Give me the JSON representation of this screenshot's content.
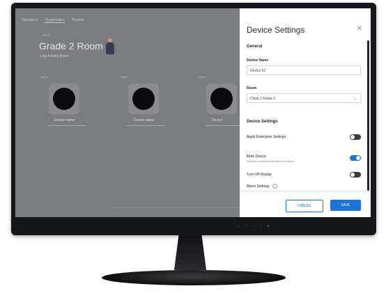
{
  "app": {
    "tabs": [
      "Operations",
      "Organization",
      "Devices"
    ],
    "back": "< BACK",
    "title": "Grade 2 Room C",
    "subtitle": "Low Activity Room",
    "devices": [
      {
        "label": "Tablet",
        "name": "Device name"
      },
      {
        "label": "Tablet",
        "name": "Device name"
      },
      {
        "label": "Tablet",
        "name": "Device"
      }
    ]
  },
  "panel": {
    "title": "Device Settings",
    "close_icon": "close-icon",
    "general_heading": "General",
    "device_name_label": "Device Name",
    "device_name_value": "Device 01",
    "room_label": "Room",
    "room_value": "Class 1 Grade 2",
    "device_settings_heading": "Device Settings",
    "apply_enterprise": {
      "label": "Apply Enterprise Settings",
      "on": false
    },
    "mute_device": {
      "label": "Mute Device",
      "help": "No alarm sound when the device is in alarm",
      "on": true
    },
    "turn_off_display": {
      "label": "Turn Off Display",
      "on": false
    },
    "alarm_settings": {
      "label": "Alarm Settings"
    },
    "cancel_label": "CANCEL",
    "save_label": "SAVE"
  },
  "colors": {
    "accent": "#1a73d6",
    "toggle_off": "#3a3c42"
  }
}
